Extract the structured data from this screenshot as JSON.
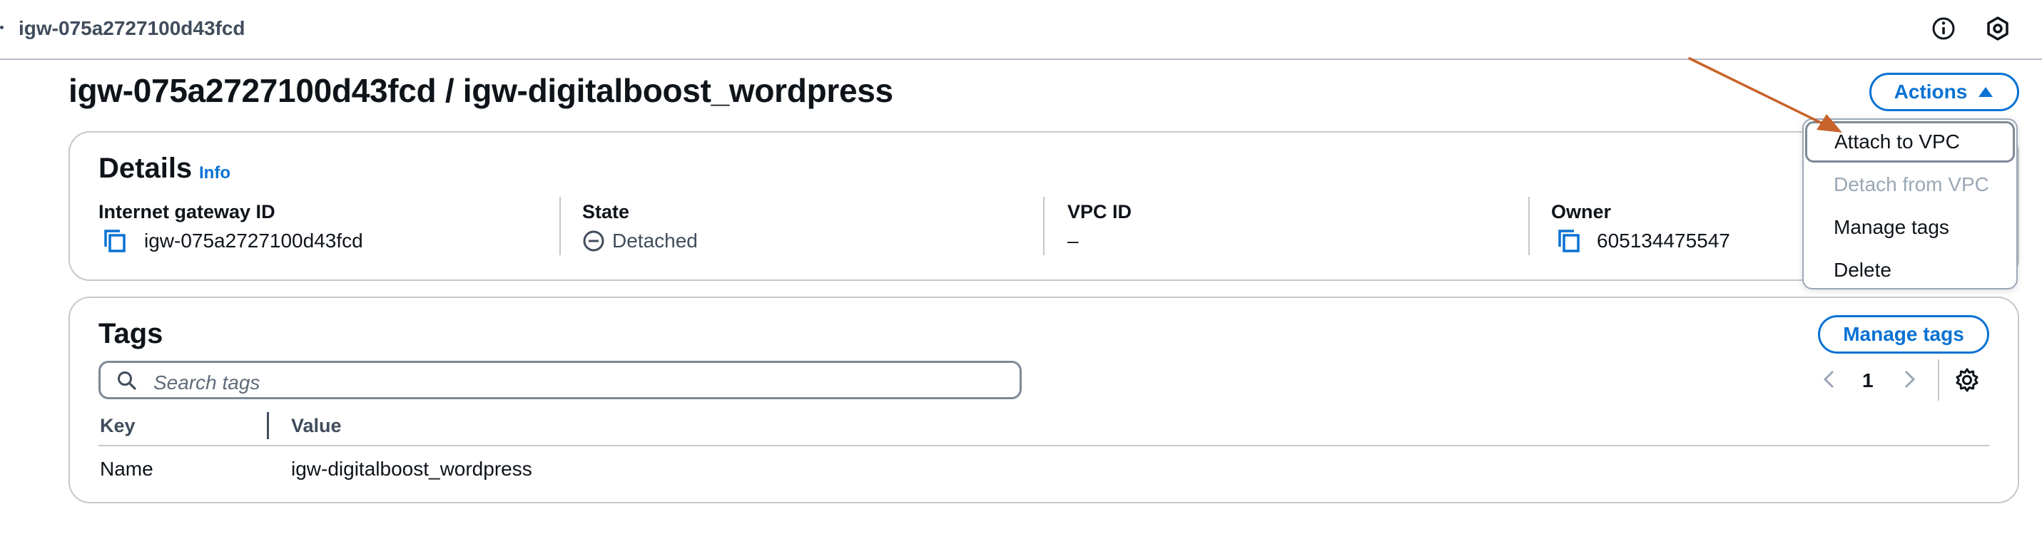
{
  "header": {
    "breadcrumb": "igw-075a2727100d43fcd",
    "icons": [
      "info-icon",
      "settings-hex-icon"
    ]
  },
  "page": {
    "title": "igw-075a2727100d43fcd / igw-digitalboost_wordpress",
    "actions_label": "Actions"
  },
  "actions_menu": {
    "items": [
      {
        "label": "Attach to VPC",
        "state": "focused"
      },
      {
        "label": "Detach from VPC",
        "state": "disabled"
      },
      {
        "label": "Manage tags",
        "state": "enabled"
      },
      {
        "label": "Delete",
        "state": "enabled"
      }
    ]
  },
  "details": {
    "title": "Details",
    "info_label": "Info",
    "columns": [
      {
        "label": "Internet gateway ID",
        "value": "igw-075a2727100d43fcd",
        "icon": "copy-icon"
      },
      {
        "label": "State",
        "value": "Detached",
        "icon": "minus-circle-icon"
      },
      {
        "label": "VPC ID",
        "value": "–"
      },
      {
        "label": "Owner",
        "value": "605134475547",
        "icon": "copy-icon"
      }
    ]
  },
  "tags": {
    "title": "Tags",
    "manage_label": "Manage tags",
    "search_placeholder": "Search tags",
    "page_number": "1",
    "columns": [
      "Key",
      "Value"
    ],
    "rows": [
      {
        "key": "Name",
        "value": "igw-digitalboost_wordpress"
      }
    ]
  },
  "colors": {
    "accent": "#0972d3",
    "annotation_arrow": "#c8632a",
    "text": "#0f141a",
    "border": "#c6c6cd"
  }
}
